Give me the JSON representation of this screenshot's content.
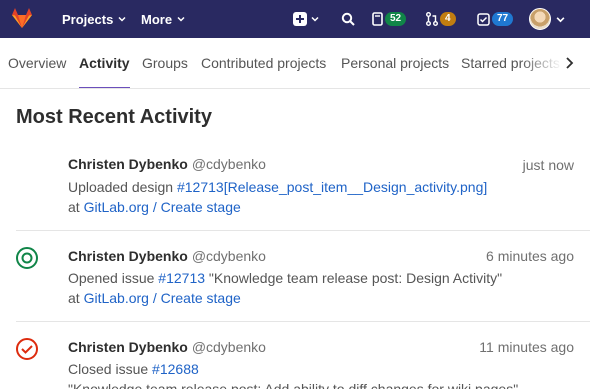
{
  "navbar": {
    "projects_label": "Projects",
    "more_label": "More",
    "todos_count": "52",
    "merge_requests_count": "4",
    "issues_count": "77",
    "icons": [
      "gitlab-logo",
      "plus-icon",
      "search-icon",
      "todos-icon",
      "merge-request-icon",
      "issues-icon",
      "avatar"
    ]
  },
  "tabs": [
    {
      "label": "Overview"
    },
    {
      "label": "Activity"
    },
    {
      "label": "Groups"
    },
    {
      "label": "Contributed projects"
    },
    {
      "label": "Personal projects"
    },
    {
      "label": "Starred projects"
    }
  ],
  "active_tab": "Activity",
  "heading": "Most Recent Activity",
  "events": [
    {
      "author_name": "Christen Dybenko",
      "username": "@cdybenko",
      "time": "just now",
      "action": "Uploaded design",
      "target": "#12713[Release_post_item__Design_activity.png]",
      "target_suffix": "",
      "location_prefix": "at",
      "location": "GitLab.org / Create stage",
      "icon": "none"
    },
    {
      "author_name": "Christen Dybenko",
      "username": "@cdybenko",
      "time": "6 minutes ago",
      "action": "Opened issue",
      "target": "#12713",
      "target_suffix": "\"Knowledge team release post: Design Activity\"",
      "location_prefix": "at",
      "location": "GitLab.org / Create stage",
      "icon": "issue-open-icon"
    },
    {
      "author_name": "Christen Dybenko",
      "username": "@cdybenko",
      "time": "11 minutes ago",
      "action": "Closed issue",
      "target": "#12688",
      "target_suffix": "",
      "line3": "\"Knowledge team release post: Add ability to diff changes for wiki pages\"",
      "icon": "issue-closed-icon"
    }
  ],
  "colors": {
    "navbar": "#292961",
    "tab_underline": "#6b4fbb",
    "link": "#1f63c7",
    "open_icon": "#108548",
    "closed_icon": "#dd2b0e"
  }
}
